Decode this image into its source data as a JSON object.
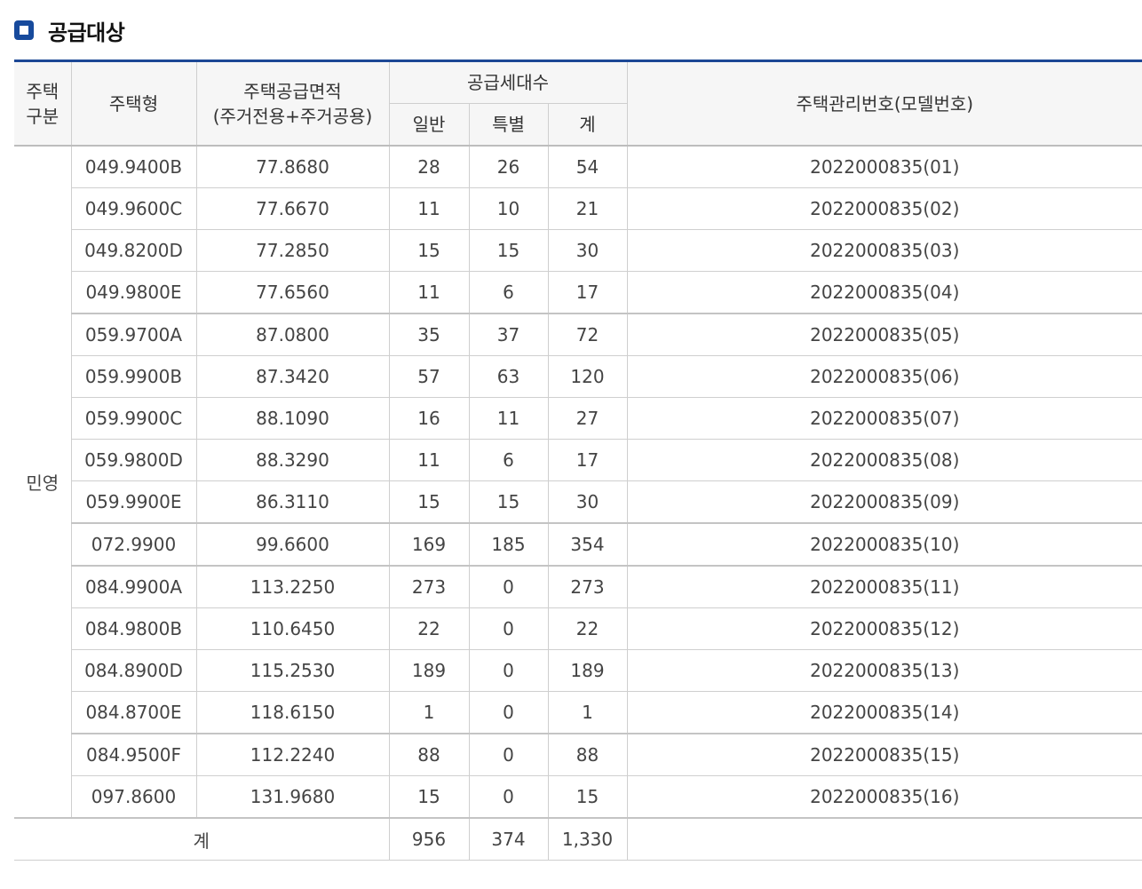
{
  "heading": {
    "title": "공급대상"
  },
  "table": {
    "headers": {
      "type_group_line1": "주택",
      "type_group_line2": "구분",
      "model": "주택형",
      "area_line1": "주택공급면적",
      "area_line2": "(주거전용+주거공용)",
      "units": "공급세대수",
      "general": "일반",
      "special": "특별",
      "total": "계",
      "mgmt_no": "주택관리번호(모델번호)"
    },
    "group_label": "민영",
    "rows": [
      {
        "model": "049.9400B",
        "area": "77.8680",
        "general": "28",
        "special": "26",
        "total": "54",
        "mgmt_no": "2022000835(01)"
      },
      {
        "model": "049.9600C",
        "area": "77.6670",
        "general": "11",
        "special": "10",
        "total": "21",
        "mgmt_no": "2022000835(02)"
      },
      {
        "model": "049.8200D",
        "area": "77.2850",
        "general": "15",
        "special": "15",
        "total": "30",
        "mgmt_no": "2022000835(03)"
      },
      {
        "model": "049.9800E",
        "area": "77.6560",
        "general": "11",
        "special": "6",
        "total": "17",
        "mgmt_no": "2022000835(04)"
      },
      {
        "model": "059.9700A",
        "area": "87.0800",
        "general": "35",
        "special": "37",
        "total": "72",
        "mgmt_no": "2022000835(05)"
      },
      {
        "model": "059.9900B",
        "area": "87.3420",
        "general": "57",
        "special": "63",
        "total": "120",
        "mgmt_no": "2022000835(06)"
      },
      {
        "model": "059.9900C",
        "area": "88.1090",
        "general": "16",
        "special": "11",
        "total": "27",
        "mgmt_no": "2022000835(07)"
      },
      {
        "model": "059.9800D",
        "area": "88.3290",
        "general": "11",
        "special": "6",
        "total": "17",
        "mgmt_no": "2022000835(08)"
      },
      {
        "model": "059.9900E",
        "area": "86.3110",
        "general": "15",
        "special": "15",
        "total": "30",
        "mgmt_no": "2022000835(09)"
      },
      {
        "model": "072.9900",
        "area": "99.6600",
        "general": "169",
        "special": "185",
        "total": "354",
        "mgmt_no": "2022000835(10)"
      },
      {
        "model": "084.9900A",
        "area": "113.2250",
        "general": "273",
        "special": "0",
        "total": "273",
        "mgmt_no": "2022000835(11)"
      },
      {
        "model": "084.9800B",
        "area": "110.6450",
        "general": "22",
        "special": "0",
        "total": "22",
        "mgmt_no": "2022000835(12)"
      },
      {
        "model": "084.8900D",
        "area": "115.2530",
        "general": "189",
        "special": "0",
        "total": "189",
        "mgmt_no": "2022000835(13)"
      },
      {
        "model": "084.8700E",
        "area": "118.6150",
        "general": "1",
        "special": "0",
        "total": "1",
        "mgmt_no": "2022000835(14)"
      },
      {
        "model": "084.9500F",
        "area": "112.2240",
        "general": "88",
        "special": "0",
        "total": "88",
        "mgmt_no": "2022000835(15)"
      },
      {
        "model": "097.8600",
        "area": "131.9680",
        "general": "15",
        "special": "0",
        "total": "15",
        "mgmt_no": "2022000835(16)"
      }
    ],
    "total_row": {
      "label": "계",
      "general": "956",
      "special": "374",
      "total": "1,330",
      "mgmt_no": ""
    }
  }
}
